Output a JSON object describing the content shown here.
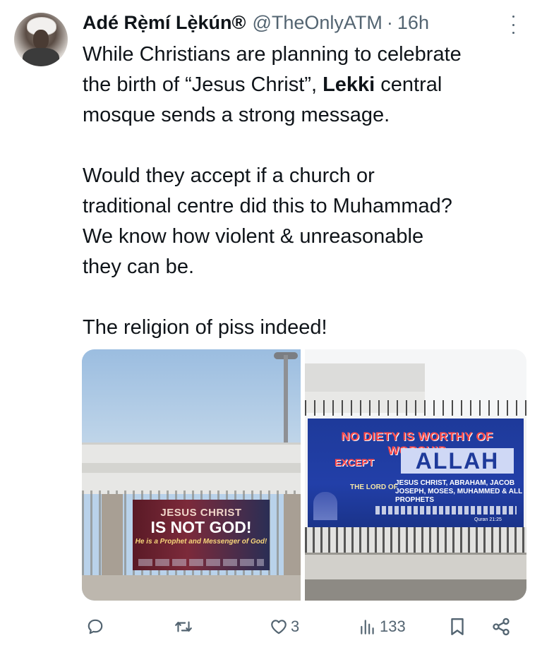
{
  "tweet": {
    "author_name": "Adé Rẹ̀mí Lẹ̀kún®",
    "handle": "@TheOnlyATM",
    "separator": "·",
    "time": "16h",
    "text": {
      "line1": "While Christians are planning to celebrate",
      "line2_a": "the birth of “Jesus Christ”, ",
      "line2_bold": "Lekki",
      "line2_b": " central",
      "line3": "mosque sends a strong message.",
      "line4": "Would they accept if a church or",
      "line5": "traditional centre did this to Muhammad?",
      "line6": "We know how violent & unreasonable",
      "line7": "they can be.",
      "line8": "The religion of piss indeed!"
    }
  },
  "media": {
    "left_banner": {
      "line1": "JESUS CHRIST",
      "line2": "IS NOT GOD!",
      "line3": "He is a Prophet and Messenger of God!"
    },
    "right_banner": {
      "line1": "NO DIETY IS WORTHY OF WORSHIP",
      "line2": "EXCEPT",
      "line3": "ALLAH",
      "line4": "THE LORD OF",
      "line5": "JESUS CHRIST, ABRAHAM, JACOB JOSEPH, MOSES, MUHAMMED & ALL PROPHETS",
      "line6": "Quran 21:25"
    }
  },
  "actions": {
    "reply_count": "",
    "retweet_count": "",
    "like_count": "3",
    "views_count": "133"
  },
  "icons": {
    "reply": "reply-icon",
    "retweet": "retweet-icon",
    "like": "heart-icon",
    "views": "views-icon",
    "bookmark": "bookmark-icon",
    "share": "share-icon",
    "more": "more-icon"
  }
}
